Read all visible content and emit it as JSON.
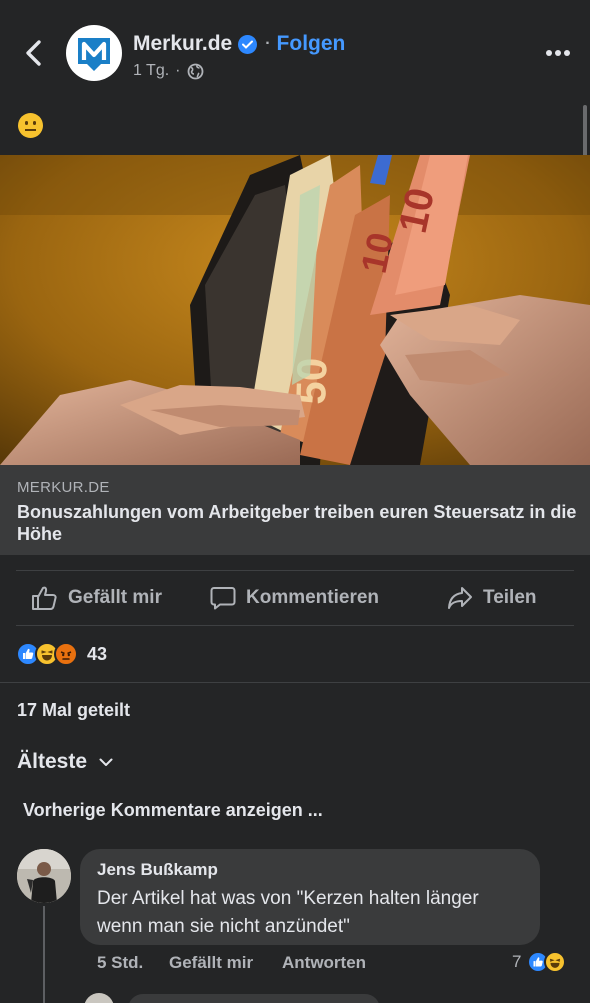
{
  "header": {
    "page_name": "Merkur.de",
    "follow_label": "Folgen",
    "separator": "·",
    "time": "1 Tg.",
    "meta_separator": "·",
    "logo_icon": "merkur-m-logo",
    "verified_icon": "verified-badge-icon",
    "audience_icon": "globe-icon"
  },
  "post": {
    "text_emoji": "neutral-face-emoji",
    "link_domain": "MERKUR.DE",
    "link_title": "Bonuszahlungen vom Arbeitgeber treiben euren Steuersatz in die Höhe"
  },
  "actions": {
    "like": "Gefällt mir",
    "comment": "Kommentieren",
    "share": "Teilen"
  },
  "reactions": {
    "types": [
      "like",
      "haha",
      "angry"
    ],
    "count": "43"
  },
  "shares_text": "17 Mal geteilt",
  "comments": {
    "sort_label": "Älteste",
    "previous_label": "Vorherige Kommentare anzeigen ...",
    "items": [
      {
        "author": "Jens Bußkamp",
        "text": "Der Artikel hat was von \"Kerzen halten länger wenn man sie nicht anzündet\"",
        "time": "5 Std.",
        "like_label": "Gefällt mir",
        "reply_label": "Antworten",
        "reaction_count": "7",
        "reaction_types": [
          "like",
          "haha"
        ]
      }
    ]
  },
  "colors": {
    "background": "#242526",
    "surface": "#3a3b3c",
    "accent": "#2d88ff",
    "link": "#4599ff",
    "secondary_text": "#b0b3b8"
  }
}
